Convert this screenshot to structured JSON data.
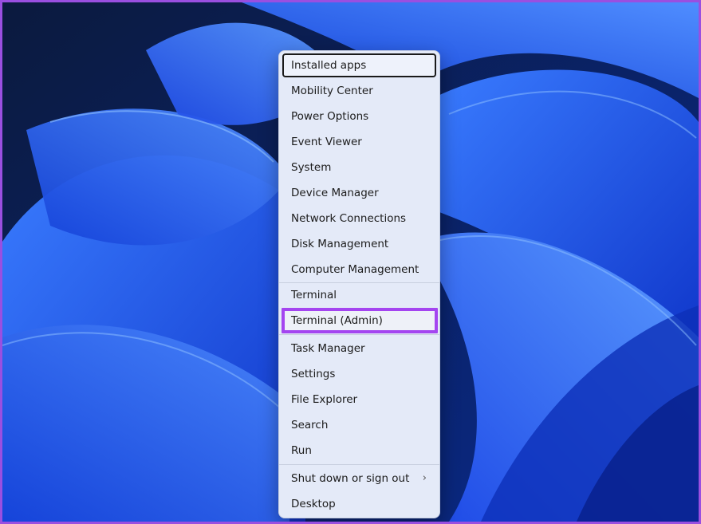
{
  "menu": {
    "items": [
      {
        "label": "Installed apps"
      },
      {
        "label": "Mobility Center"
      },
      {
        "label": "Power Options"
      },
      {
        "label": "Event Viewer"
      },
      {
        "label": "System"
      },
      {
        "label": "Device Manager"
      },
      {
        "label": "Network Connections"
      },
      {
        "label": "Disk Management"
      },
      {
        "label": "Computer Management"
      },
      {
        "label": "Terminal"
      },
      {
        "label": "Terminal (Admin)"
      },
      {
        "label": "Task Manager"
      },
      {
        "label": "Settings"
      },
      {
        "label": "File Explorer"
      },
      {
        "label": "Search"
      },
      {
        "label": "Run"
      },
      {
        "label": "Shut down or sign out"
      },
      {
        "label": "Desktop"
      }
    ],
    "submenu_icon": "chevron-right-icon"
  },
  "colors": {
    "highlight_border": "#a445f0",
    "menu_background": "#e4eaf8",
    "wallpaper_blue": "#1f4fe8"
  }
}
